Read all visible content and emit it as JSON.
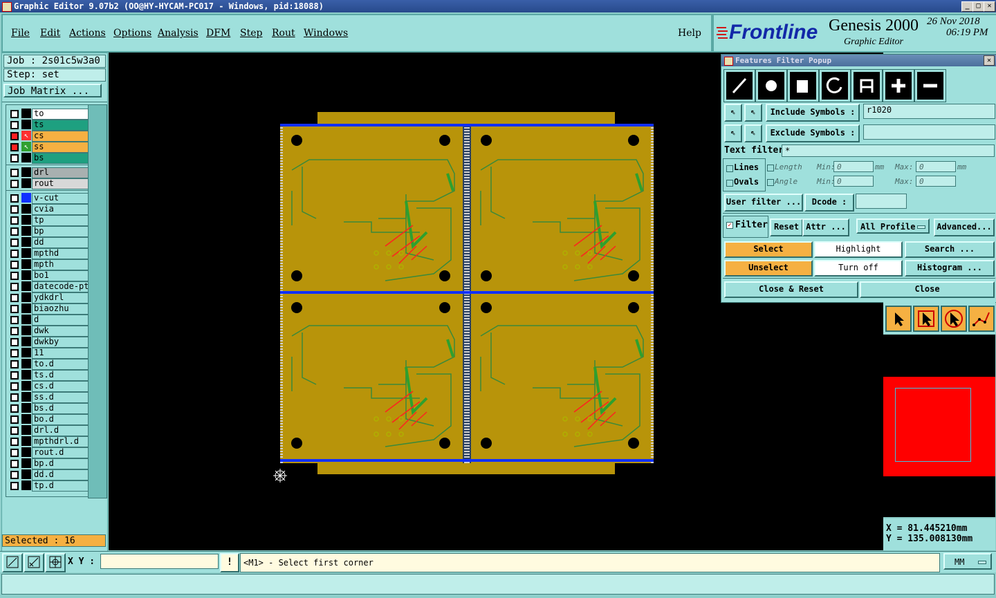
{
  "window": {
    "title": "Graphic Editor 9.07b2 (OO@HY-HYCAM-PC017 - Windows, pid:18088)",
    "min": "_",
    "max": "□",
    "close": "✕"
  },
  "menu": {
    "items": [
      "File",
      "Edit",
      "Actions",
      "Options",
      "Analysis",
      "DFM",
      "Step",
      "Rout",
      "Windows"
    ],
    "help": "Help"
  },
  "brand": {
    "logo": "Frontline",
    "product": "Genesis 2000",
    "subtitle": "Graphic Editor",
    "date": "26 Nov 2018",
    "time": "06:19 PM"
  },
  "left": {
    "job": "Job : 2s01c5w3a0",
    "step": "Step: set",
    "job_matrix": "Job Matrix ...",
    "selected": "Selected : 16",
    "layers": [
      {
        "name": "to",
        "color": "#000000",
        "bg": "#ffffff"
      },
      {
        "name": "ts",
        "color": "#000000",
        "bg": "#1ea080"
      },
      {
        "name": "cs",
        "color": "#ff4040",
        "bg": "#f5b042",
        "active": true
      },
      {
        "name": "ss",
        "color": "#ff4040",
        "bg": "#f5b042",
        "active": true
      },
      {
        "name": "bs",
        "color": "#000000",
        "bg": "#1ea080"
      },
      {
        "name": "drl",
        "color": "#000000",
        "bg": "#a8b0b0"
      },
      {
        "name": "rout",
        "color": "#000000",
        "bg": "#d8d8d8"
      },
      {
        "name": "v-cut",
        "color": "#1030ff",
        "bg": "#9fe0dc"
      },
      {
        "name": "cvia",
        "color": "#000000",
        "bg": "#9fe0dc"
      },
      {
        "name": "tp",
        "color": "#000000",
        "bg": "#9fe0dc"
      },
      {
        "name": "bp",
        "color": "#000000",
        "bg": "#9fe0dc"
      },
      {
        "name": "dd",
        "color": "#000000",
        "bg": "#9fe0dc"
      },
      {
        "name": "mpthd",
        "color": "#000000",
        "bg": "#9fe0dc"
      },
      {
        "name": "mpth",
        "color": "#000000",
        "bg": "#9fe0dc"
      },
      {
        "name": "bo1",
        "color": "#000000",
        "bg": "#9fe0dc"
      },
      {
        "name": "datecode-ptc",
        "color": "#000000",
        "bg": "#9fe0dc"
      },
      {
        "name": "ydkdrl",
        "color": "#000000",
        "bg": "#9fe0dc"
      },
      {
        "name": "biaozhu",
        "color": "#000000",
        "bg": "#9fe0dc"
      },
      {
        "name": "d",
        "color": "#000000",
        "bg": "#9fe0dc"
      },
      {
        "name": "dwk",
        "color": "#000000",
        "bg": "#9fe0dc"
      },
      {
        "name": "dwkby",
        "color": "#000000",
        "bg": "#9fe0dc"
      },
      {
        "name": "11",
        "color": "#000000",
        "bg": "#9fe0dc"
      },
      {
        "name": "to.d",
        "color": "#000000",
        "bg": "#9fe0dc"
      },
      {
        "name": "ts.d",
        "color": "#000000",
        "bg": "#9fe0dc"
      },
      {
        "name": "cs.d",
        "color": "#000000",
        "bg": "#9fe0dc"
      },
      {
        "name": "ss.d",
        "color": "#000000",
        "bg": "#9fe0dc"
      },
      {
        "name": "bs.d",
        "color": "#000000",
        "bg": "#9fe0dc"
      },
      {
        "name": "bo.d",
        "color": "#000000",
        "bg": "#9fe0dc"
      },
      {
        "name": "drl.d",
        "color": "#000000",
        "bg": "#9fe0dc"
      },
      {
        "name": "mpthdrl.d",
        "color": "#000000",
        "bg": "#9fe0dc"
      },
      {
        "name": "rout.d",
        "color": "#000000",
        "bg": "#9fe0dc"
      },
      {
        "name": "bp.d",
        "color": "#000000",
        "bg": "#9fe0dc"
      },
      {
        "name": "dd.d",
        "color": "#000000",
        "bg": "#9fe0dc"
      },
      {
        "name": "tp.d",
        "color": "#000000",
        "bg": "#9fe0dc"
      }
    ]
  },
  "popup": {
    "title": "Features Filter Popup",
    "include_label": "Include Symbols :",
    "include_value": "r1020",
    "exclude_label": "Exclude Symbols :",
    "exclude_value": "",
    "text_filter_label": "Text filter",
    "text_filter_value": "*",
    "lines": "Lines",
    "ovals": "Ovals",
    "length": "Length",
    "angle": "Angle",
    "min": "Min:",
    "max": "Max:",
    "unit_mm": "mm",
    "zero": "0",
    "user_filter": "User filter ...",
    "dcode": "Dcode :",
    "filter": "Filter",
    "reset": "Reset",
    "attr": "Attr ...",
    "all_profile": "All Profile",
    "advanced": "Advanced...",
    "select": "Select",
    "highlight": "Highlight",
    "search": "Search ...",
    "unselect": "Unselect",
    "turn_off": "Turn off",
    "histogram": "Histogram ...",
    "close_reset": "Close & Reset",
    "close": "Close"
  },
  "coords": {
    "x": "X = 81.445210mm",
    "y": "Y = 135.008130mm"
  },
  "bottom": {
    "xy_label": "X Y :",
    "xy_value": "",
    "warn": "!",
    "prompt": "<M1> - Select first corner",
    "units": "MM"
  }
}
